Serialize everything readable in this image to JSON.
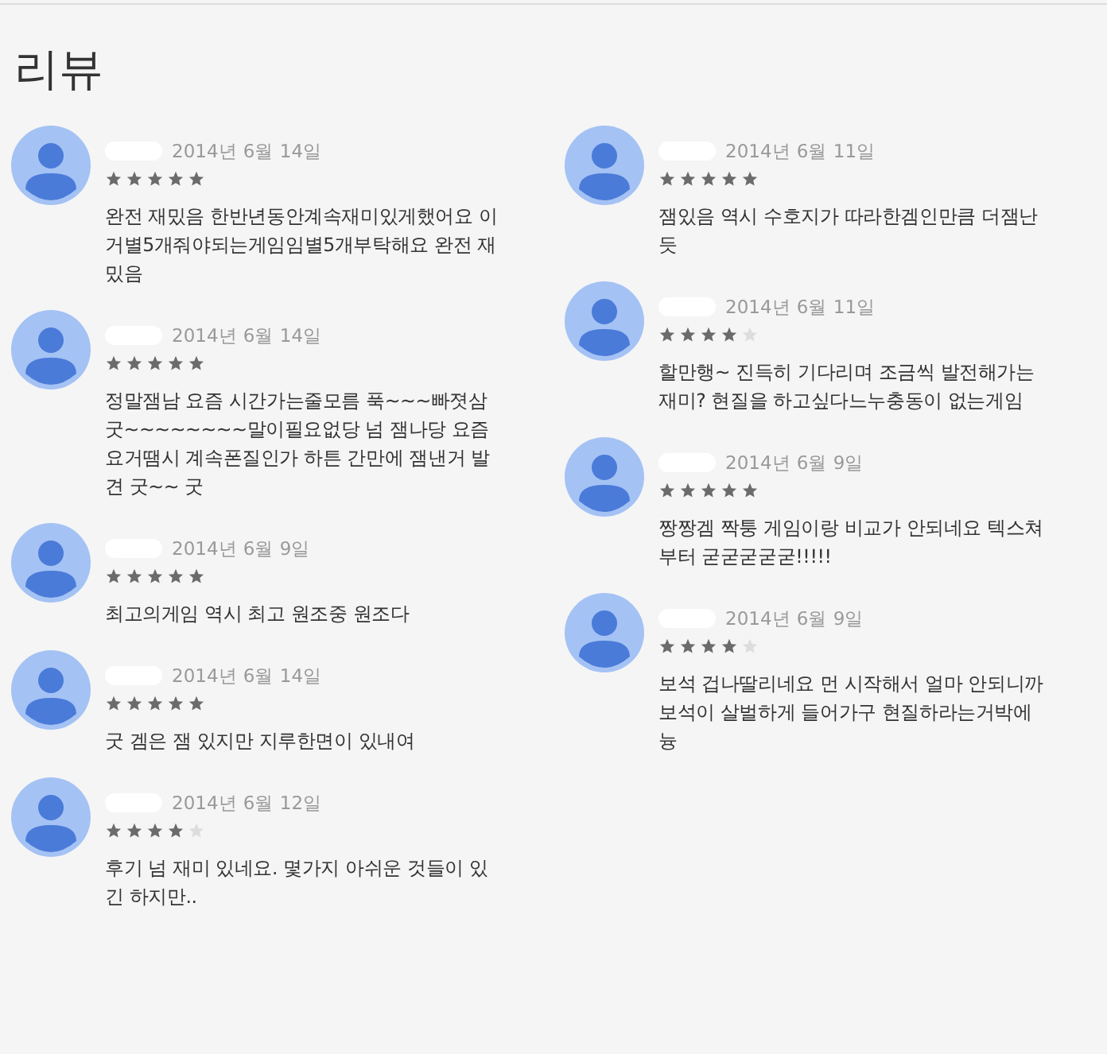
{
  "title": "리뷰",
  "columns": [
    {
      "reviews": [
        {
          "date": "2014년 6월 14일",
          "stars": 5,
          "text": "완전 재밌음 한반년동안계속재미있게했어요 이거별5개줘야되는게임임별5개부탁해요 완전 재밌음"
        },
        {
          "date": "2014년 6월 14일",
          "stars": 5,
          "text": "정말잼남 요즘 시간가는줄모름 푹~~~빠졋삼 굿~~~~~~~~말이필요없당 넘 잼나당 요즘 요거땜시 계속폰질인가 하튼 간만에 잼낸거 발견 굿~~ 굿"
        },
        {
          "date": "2014년 6월 9일",
          "stars": 5,
          "text": "최고의게임 역시 최고 원조중 원조다"
        },
        {
          "date": "2014년 6월 14일",
          "stars": 5,
          "text": "굿 겜은 잼 있지만 지루한면이 있내여"
        },
        {
          "date": "2014년 6월 12일",
          "stars": 4,
          "text": "후기 넘 재미 있네요. 몇가지 아쉬운 것들이 있긴 하지만.."
        }
      ]
    },
    {
      "reviews": [
        {
          "date": "2014년 6월 11일",
          "stars": 5,
          "text": "잼있음 역시 수호지가 따라한겜인만큼 더잼난듯"
        },
        {
          "date": "2014년 6월 11일",
          "stars": 4,
          "text": "할만행~ 진득히 기다리며 조금씩 발전해가는 재미? 현질을 하고싶다느누충동이 없는게임"
        },
        {
          "date": "2014년 6월 9일",
          "stars": 5,
          "text": "짱짱겜 짝퉁 게임이랑 비교가 안되네요 텍스쳐부터 굳굳굳굳굳!!!!!"
        },
        {
          "date": "2014년 6월 9일",
          "stars": 4,
          "text": "보석 겁나딸리네요 먼 시작해서 얼마 안되니까 보석이 살벌하게 들어가구 현질하라는거박에 늉"
        }
      ]
    }
  ]
}
